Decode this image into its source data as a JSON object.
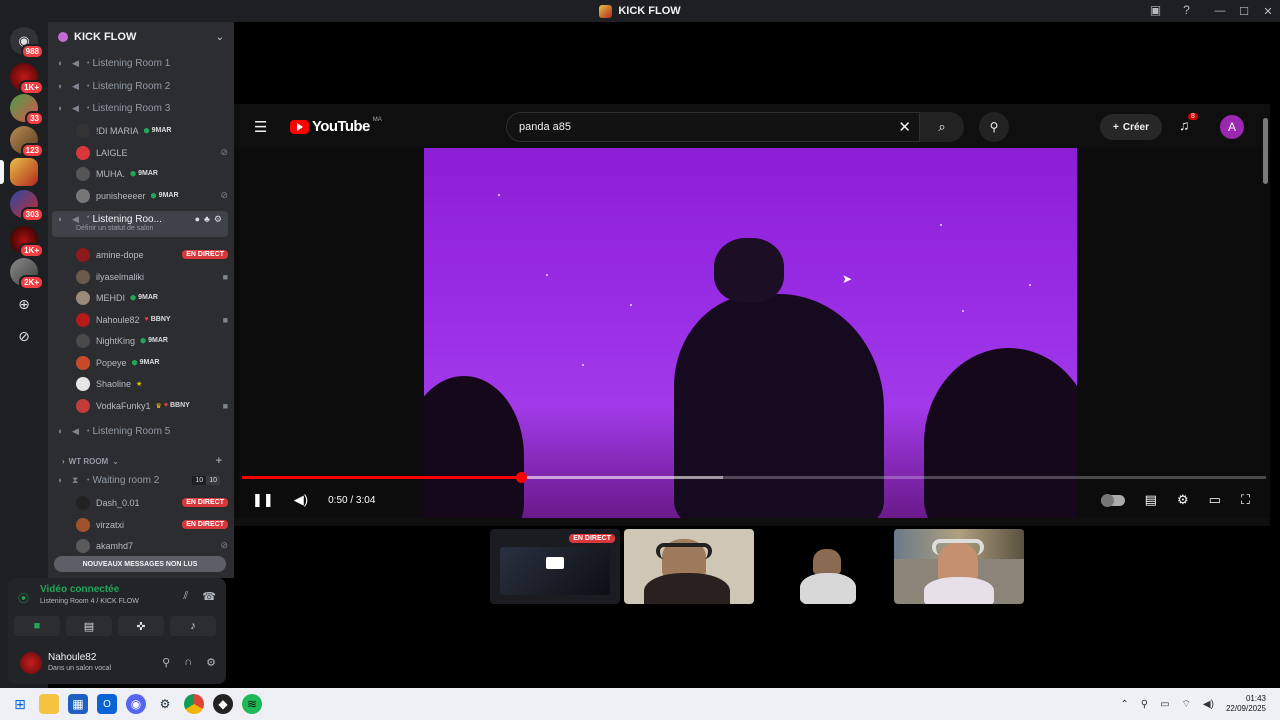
{
  "window": {
    "title": "KICK FLOW"
  },
  "rail": {
    "badges": [
      "988",
      "1K+",
      "33",
      "123",
      "303",
      "1K+",
      "2K+"
    ]
  },
  "sidebar": {
    "guild_name": "KICK FLOW",
    "channels": [
      {
        "label": "Listening Room 1"
      },
      {
        "label": "Listening Room 2"
      },
      {
        "label": "Listening Room 3"
      }
    ],
    "room3_users": [
      {
        "name": "!DI MARIA",
        "tag": "9MAR"
      },
      {
        "name": "LAIGLE",
        "tag": ""
      },
      {
        "name": "MUHA.",
        "tag": "9MAR"
      },
      {
        "name": "punisheeeer",
        "tag": "9MAR"
      }
    ],
    "active_channel": {
      "label": "Listening Roo...",
      "status_hint": "Définir un statut de salon"
    },
    "room4_users": [
      {
        "name": "amine-dope",
        "tag": "",
        "live": "EN DIRECT"
      },
      {
        "name": "ilyaselmaliki",
        "tag": "",
        "live": ""
      },
      {
        "name": "MEHDI",
        "tag": "9MAR",
        "live": ""
      },
      {
        "name": "Nahoule82",
        "tag": "BBNY",
        "live": ""
      },
      {
        "name": "NightKing",
        "tag": "9MAR",
        "live": ""
      },
      {
        "name": "Popeye",
        "tag": "9MAR",
        "live": ""
      },
      {
        "name": "Shaoline",
        "tag": "",
        "live": ""
      },
      {
        "name": "VodkaFunky1",
        "tag": "BBNY",
        "live": ""
      }
    ],
    "room5": {
      "label": "Listening Room 5"
    },
    "category": {
      "label": "WT ROOM"
    },
    "waiting_room": {
      "label": "Waiting room 2",
      "count_a": "10",
      "count_b": "10"
    },
    "waiting_users": [
      {
        "name": "Dash_0.01",
        "live": "EN DIRECT"
      },
      {
        "name": "virzatxi",
        "live": "EN DIRECT"
      },
      {
        "name": "akamhd7",
        "live": ""
      }
    ],
    "unread_label": "NOUVEAUX MESSAGES NON LUS"
  },
  "voice_panel": {
    "title": "Vidéo connectée",
    "subtitle": "Listening Room 4 / KICK FLOW"
  },
  "user_panel": {
    "name": "Nahoule82",
    "status": "Dans un salon vocal"
  },
  "youtube": {
    "logo_text": "YouTube",
    "country_code": "MA",
    "search_value": "panda a85",
    "create_label": "Créer",
    "notif_count": "8",
    "account_initial": "A",
    "time": "0:50 / 3:04",
    "progress_fraction": 0.272,
    "buffer_fraction": 0.47
  },
  "streams": [
    {
      "live": "EN DIRECT"
    }
  ],
  "taskbar": {
    "time": "01:43",
    "date": "22/09/2025"
  },
  "colors": {
    "discord_bg": "#2b2d31",
    "rail_bg": "#1e1f22",
    "live_red": "#da373c",
    "connected_green": "#23a55a",
    "yt_red": "#ff0000",
    "video_purple": "#9a2ee6"
  }
}
